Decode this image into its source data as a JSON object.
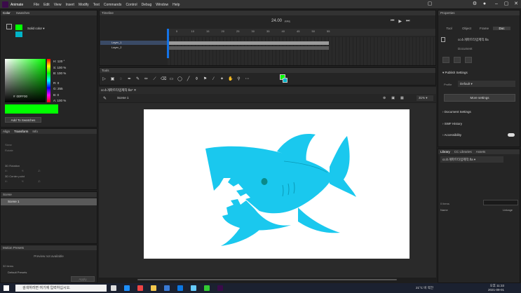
{
  "app": {
    "name": "Animate"
  },
  "menu": [
    "File",
    "Edit",
    "View",
    "Insert",
    "Modify",
    "Text",
    "Commands",
    "Control",
    "Debug",
    "Window",
    "Help"
  ],
  "color_panel": {
    "tabs": [
      "Color",
      "Swatches"
    ],
    "fill_type": "Solid color",
    "hsb": {
      "h": "H: 120 °",
      "s": "S: 100 %",
      "b": "B: 100 %"
    },
    "rgb": {
      "r": "R: 0",
      "g": "G: 255",
      "b": "B: 0"
    },
    "alpha": "A: 100 %",
    "hex": "00FF00",
    "hex_prefix": "#",
    "add_swatch": "Add To Swatches",
    "fill_color": "#00ff00",
    "stroke_color": "#00b4c8"
  },
  "align_panel": {
    "tabs": [
      "Align",
      "Transform",
      "Info"
    ],
    "rows": [
      {
        "label": "Skew"
      },
      {
        "label": "Rotate"
      }
    ],
    "rotation_3d": "3D Rotation",
    "center_3d": "3D Center point",
    "x_label": "X:",
    "y_label": "Y:",
    "z_label": "Z:"
  },
  "scene_panel": {
    "title": "Scene",
    "items": [
      "Scene 1"
    ]
  },
  "motion_presets": {
    "title": "Motion Presets",
    "preview": "Preview not available",
    "count": "32 items",
    "folder": "Default Presets",
    "apply": "Apply"
  },
  "timeline": {
    "title": "Timeline",
    "fps": "24.00",
    "fps_unit": "FPS",
    "frame_labels": [
      "5",
      "10",
      "15",
      "20",
      "25",
      "30",
      "35",
      "40",
      "45",
      "50",
      "55"
    ],
    "frame_labels_far": [
      "5",
      "10",
      "15",
      "20",
      "25",
      "30",
      "35",
      "40",
      "45",
      "50",
      "55",
      "60"
    ],
    "layers": [
      {
        "name": "Layer_1",
        "selected": true
      },
      {
        "name": "Layer_2",
        "selected": false
      }
    ]
  },
  "tools": {
    "title": "Tools"
  },
  "document": {
    "tab_name": "cc소개파트타입제작.fla*",
    "scene": "Scene 1",
    "zoom": "31%"
  },
  "properties": {
    "title": "Properties",
    "tabs": [
      "Tool",
      "Object",
      "Frame",
      "Doc"
    ],
    "active_tab": "Doc",
    "doc_name": "cc소개파트타입제작.fla",
    "doc_label": "Document",
    "publish_settings": "Publish Settings",
    "profile_label": "Profile",
    "profile_value": "Default",
    "more_settings": "More settings",
    "doc_settings": "Document Settings",
    "swf_history": "SWF History",
    "accessibility": "Accessibility"
  },
  "library": {
    "tabs": [
      "Library",
      "CC Libraries",
      "Assets"
    ],
    "selected_doc": "cc소개파트타입제작.fla",
    "items_count": "0 items",
    "search_placeholder": "",
    "col_name": "Name",
    "col_linkage": "Linkage"
  },
  "taskbar": {
    "search_text": "검색하려면 여기에 입력하십시오.",
    "weather": "21°C 비 약간",
    "time": "오후 11:33",
    "date": "2021-09-01",
    "lang": "A"
  },
  "colors": {
    "shark": "#1ac8ee",
    "stage": "#ffffff",
    "accent": "#1473e6"
  }
}
